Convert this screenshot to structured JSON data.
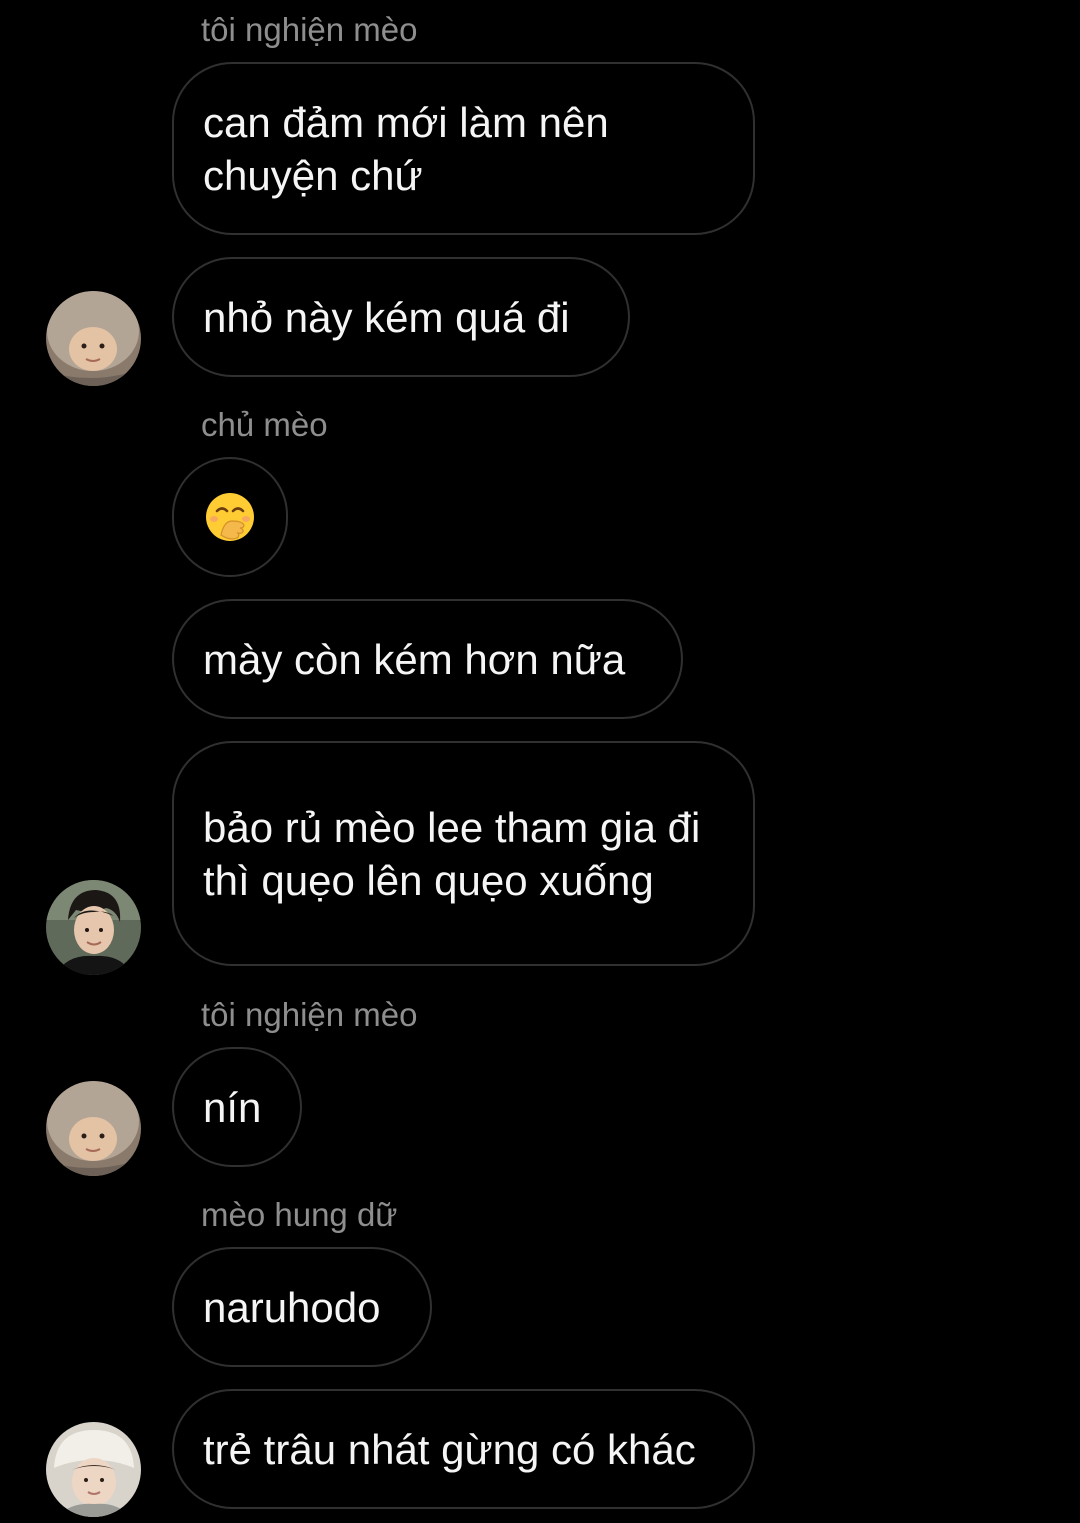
{
  "messages": [
    {
      "sender": "tôi nghiện mèo",
      "text": "can đảm mới làm nên chuyện chứ"
    },
    {
      "text": "nhỏ này kém quá đi",
      "avatar": "avatar-fur-hood"
    },
    {
      "sender": "chủ mèo",
      "emoji": "hand-over-mouth-emoji"
    },
    {
      "text": "mày còn kém hơn nữa"
    },
    {
      "text": "bảo rủ mèo lee tham gia đi thì quẹo lên quẹo xuống",
      "avatar": "avatar-dark-hair"
    },
    {
      "sender": "tôi nghiện mèo",
      "text": "nín",
      "avatar": "avatar-fur-hood"
    },
    {
      "sender": "mèo hung dữ",
      "text": "naruhodo"
    },
    {
      "text": "trẻ trâu nhát gừng có khác",
      "avatar": "avatar-white-hat"
    }
  ],
  "colors": {
    "background": "#000000",
    "bubble_border": "#303030",
    "message_text": "#f5f5f5",
    "sender_text": "#8e8e8e"
  }
}
